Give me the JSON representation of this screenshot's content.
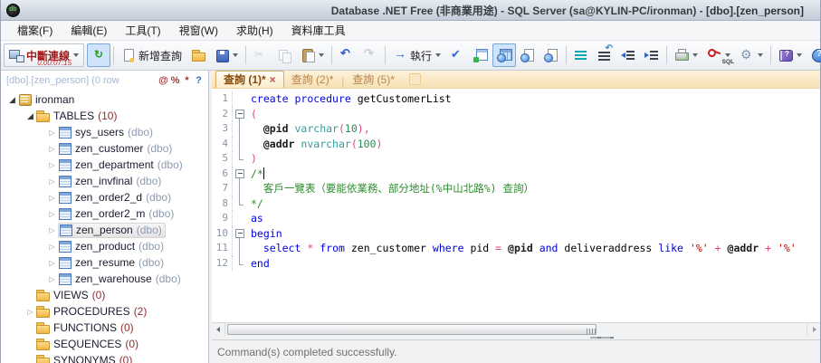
{
  "window": {
    "title_left": "Database .NET Free (非商業用途) - SQL Server (sa@KYLIN-PC/ironman)",
    "title_sep": " - ",
    "title_doc": "[dbo].[zen_person]"
  },
  "menu": {
    "items": [
      {
        "name": "file",
        "label": "檔案(F)"
      },
      {
        "name": "edit",
        "label": "編輯(E)"
      },
      {
        "name": "tools",
        "label": "工具(T)"
      },
      {
        "name": "window",
        "label": "視窗(W)"
      },
      {
        "name": "help",
        "label": "求助(H)"
      },
      {
        "name": "db-tools",
        "label": "資料庫工具"
      }
    ]
  },
  "toolbar": {
    "buttons": [
      {
        "name": "disconnect-button",
        "icon": "disconnect-computer",
        "label": "中斷連線",
        "timer": "0.00:07:15",
        "dropdown": true,
        "special": "disconnect"
      },
      {
        "name": "auto-refresh-button",
        "icon": "refresh",
        "toggled": true
      },
      {
        "sep": true
      },
      {
        "name": "new-query-button",
        "icon": "new-document",
        "label": "新增查詢"
      },
      {
        "name": "open-file-button",
        "icon": "folder-open"
      },
      {
        "name": "save-button",
        "icon": "save",
        "dropdown": true
      },
      {
        "sep": true
      },
      {
        "name": "cut-button",
        "icon": "scissors",
        "disabled": true
      },
      {
        "name": "copy-button",
        "icon": "copy",
        "disabled": true
      },
      {
        "name": "paste-button",
        "icon": "paste",
        "dropdown": true
      },
      {
        "sep": true
      },
      {
        "name": "undo-button",
        "icon": "undo"
      },
      {
        "name": "redo-button",
        "icon": "redo",
        "disabled": true
      },
      {
        "sep": true
      },
      {
        "name": "execute-button",
        "icon": "execute-arrow",
        "label": "執行",
        "dropdown": true
      },
      {
        "name": "validate-button",
        "icon": "checkmark"
      },
      {
        "name": "execution-plan-button",
        "icon": "execution-plan"
      },
      {
        "name": "results-grid-button",
        "icon": "results-grid",
        "toggled": true
      },
      {
        "name": "results-text-button",
        "icon": "results-text"
      },
      {
        "name": "results-file-button",
        "icon": "results-file"
      },
      {
        "sep": true
      },
      {
        "name": "comment-button",
        "icon": "comment-lines"
      },
      {
        "name": "uncomment-button",
        "icon": "uncomment-lines"
      },
      {
        "name": "outdent-button",
        "icon": "outdent"
      },
      {
        "name": "indent-button",
        "icon": "indent"
      },
      {
        "sep": true
      },
      {
        "name": "print-button",
        "icon": "printer",
        "dropdown": true
      },
      {
        "name": "sql-formatter-button",
        "icon": "sql-key",
        "sublabel": "SQL",
        "dropdown": true
      },
      {
        "name": "options-button",
        "icon": "gear",
        "dropdown": true
      },
      {
        "sep": true
      },
      {
        "name": "help-book-button",
        "icon": "help-book",
        "dropdown": true
      },
      {
        "name": "about-button",
        "icon": "help-circle"
      },
      {
        "name": "toggle-results-pane-button",
        "icon": "document-check",
        "toggled": true
      }
    ]
  },
  "sidebar": {
    "header": {
      "title": "[dbo].[zen_person] (0 row",
      "buttons": [
        {
          "name": "filter-at-button",
          "label": "@"
        },
        {
          "name": "filter-percent-button",
          "label": "%"
        },
        {
          "name": "filter-star-button",
          "label": "*"
        },
        {
          "name": "filter-help-button",
          "label": "?"
        }
      ]
    },
    "tree": [
      {
        "level": 0,
        "arrow": "expanded",
        "icon": "database",
        "label": "ironman"
      },
      {
        "level": 1,
        "arrow": "expanded",
        "icon": "folder",
        "label": "TABLES",
        "count": "(10)"
      },
      {
        "level": 2,
        "arrow": "collapsed",
        "icon": "table",
        "label": "sys_users",
        "suffix": "(dbo)"
      },
      {
        "level": 2,
        "arrow": "collapsed",
        "icon": "table",
        "label": "zen_customer",
        "suffix": "(dbo)"
      },
      {
        "level": 2,
        "arrow": "collapsed",
        "icon": "table",
        "label": "zen_department",
        "suffix": "(dbo)"
      },
      {
        "level": 2,
        "arrow": "collapsed",
        "icon": "table",
        "label": "zen_invfinal",
        "suffix": "(dbo)"
      },
      {
        "level": 2,
        "arrow": "collapsed",
        "icon": "table",
        "label": "zen_order2_d",
        "suffix": "(dbo)"
      },
      {
        "level": 2,
        "arrow": "collapsed",
        "icon": "table",
        "label": "zen_order2_m",
        "suffix": "(dbo)"
      },
      {
        "level": 2,
        "arrow": "collapsed",
        "icon": "table",
        "label": "zen_person",
        "suffix": "(dbo)",
        "selected": true
      },
      {
        "level": 2,
        "arrow": "collapsed",
        "icon": "table",
        "label": "zen_product",
        "suffix": "(dbo)"
      },
      {
        "level": 2,
        "arrow": "collapsed",
        "icon": "table",
        "label": "zen_resume",
        "suffix": "(dbo)"
      },
      {
        "level": 2,
        "arrow": "collapsed",
        "icon": "table",
        "label": "zen_warehouse",
        "suffix": "(dbo)"
      },
      {
        "level": 1,
        "arrow": "none",
        "icon": "folder",
        "label": "VIEWS",
        "count": "(0)"
      },
      {
        "level": 1,
        "arrow": "collapsed",
        "icon": "folder",
        "label": "PROCEDURES",
        "count": "(2)"
      },
      {
        "level": 1,
        "arrow": "none",
        "icon": "folder",
        "label": "FUNCTIONS",
        "count": "(0)"
      },
      {
        "level": 1,
        "arrow": "none",
        "icon": "folder",
        "label": "SEQUENCES",
        "count": "(0)"
      },
      {
        "level": 1,
        "arrow": "none",
        "icon": "folder",
        "label": "SYNONYMS",
        "count": "(0)"
      }
    ]
  },
  "editor": {
    "tabs": [
      {
        "name": "tab-query-1",
        "label": "查詢 (1)*",
        "active": true,
        "closable": true
      },
      {
        "name": "tab-query-2",
        "label": "查詢 (2)*",
        "active": false
      },
      {
        "name": "tab-query-5",
        "label": "查詢 (5)*",
        "active": false
      }
    ],
    "lines": [
      {
        "n": 1,
        "fold": "",
        "tokens": [
          [
            "kw",
            "create"
          ],
          [
            "ws",
            " "
          ],
          [
            "kw",
            "procedure"
          ],
          [
            "ws",
            " "
          ],
          [
            "id",
            "getCustomerList"
          ]
        ]
      },
      {
        "n": 2,
        "fold": "start",
        "tokens": [
          [
            "op",
            "("
          ]
        ]
      },
      {
        "n": 3,
        "fold": "mid",
        "tokens": [
          [
            "ws",
            "  "
          ],
          [
            "va",
            "@pid"
          ],
          [
            "ws",
            " "
          ],
          [
            "ty",
            "varchar"
          ],
          [
            "op",
            "("
          ],
          [
            "nu",
            "10"
          ],
          [
            "op",
            "),"
          ]
        ]
      },
      {
        "n": 4,
        "fold": "mid",
        "tokens": [
          [
            "ws",
            "  "
          ],
          [
            "va",
            "@addr"
          ],
          [
            "ws",
            " "
          ],
          [
            "ty",
            "nvarchar"
          ],
          [
            "op",
            "("
          ],
          [
            "nu",
            "100"
          ],
          [
            "op",
            ")"
          ]
        ]
      },
      {
        "n": 5,
        "fold": "end",
        "tokens": [
          [
            "op",
            ")"
          ]
        ]
      },
      {
        "n": 6,
        "fold": "start",
        "cursor": true,
        "tokens": [
          [
            "cm",
            "/*"
          ]
        ]
      },
      {
        "n": 7,
        "fold": "mid",
        "tokens": [
          [
            "ws",
            "  "
          ],
          [
            "cm",
            "客戶一覽表（要能依業務、部分地址(%中山北路%) 查詢）"
          ]
        ]
      },
      {
        "n": 8,
        "fold": "end",
        "tokens": [
          [
            "cm",
            "*/"
          ]
        ]
      },
      {
        "n": 9,
        "fold": "",
        "tokens": [
          [
            "kw",
            "as"
          ]
        ]
      },
      {
        "n": 10,
        "fold": "start",
        "tokens": [
          [
            "kw",
            "begin"
          ]
        ]
      },
      {
        "n": 11,
        "fold": "mid",
        "tokens": [
          [
            "ws",
            "  "
          ],
          [
            "kw",
            "select"
          ],
          [
            "ws",
            " "
          ],
          [
            "op",
            "*"
          ],
          [
            "ws",
            " "
          ],
          [
            "kw",
            "from"
          ],
          [
            "ws",
            " "
          ],
          [
            "id",
            "zen_customer"
          ],
          [
            "ws",
            " "
          ],
          [
            "kw",
            "where"
          ],
          [
            "ws",
            " "
          ],
          [
            "id",
            "pid"
          ],
          [
            "ws",
            " "
          ],
          [
            "op",
            "="
          ],
          [
            "ws",
            " "
          ],
          [
            "va",
            "@pid"
          ],
          [
            "ws",
            " "
          ],
          [
            "kw",
            "and"
          ],
          [
            "ws",
            " "
          ],
          [
            "id",
            "deliveraddress"
          ],
          [
            "ws",
            " "
          ],
          [
            "kw",
            "like"
          ],
          [
            "ws",
            " "
          ],
          [
            "st",
            "'%'"
          ],
          [
            "ws",
            " "
          ],
          [
            "op",
            "+"
          ],
          [
            "ws",
            " "
          ],
          [
            "va",
            "@addr"
          ],
          [
            "ws",
            " "
          ],
          [
            "op",
            "+"
          ],
          [
            "ws",
            " "
          ],
          [
            "st",
            "'%'"
          ]
        ]
      },
      {
        "n": 12,
        "fold": "end",
        "tokens": [
          [
            "kw",
            "end"
          ]
        ]
      }
    ]
  },
  "statusbar": {
    "message": "Command(s) completed successfully."
  },
  "colors": {
    "syntax_keyword": "#0000e0",
    "syntax_datatype": "#2f9e9e",
    "syntax_number": "#2e8b57",
    "syntax_operator": "#e0457b",
    "syntax_string": "#c00000",
    "syntax_comment": "#2e8b2e",
    "disconnect_text": "#9e1b1b",
    "timer_text": "#c03030",
    "active_tab_text": "#8a4a0a",
    "tree_count_text": "#8f2f2f",
    "tree_schema_text": "#8d9bb0",
    "toggled_button_bg": "#cfe3fa"
  }
}
